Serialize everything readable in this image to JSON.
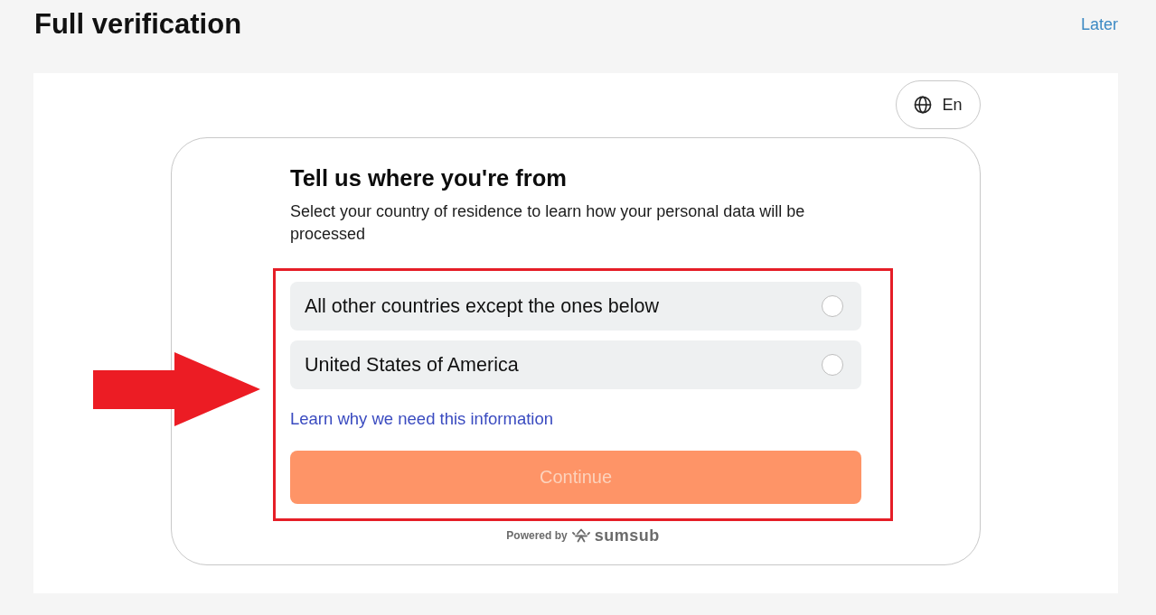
{
  "header": {
    "title": "Full verification",
    "later_link": "Later"
  },
  "language_button": {
    "label": "En"
  },
  "form": {
    "heading": "Tell us where you're from",
    "description": "Select your country of residence to learn how your personal data will be processed",
    "options": [
      {
        "label": "All other countries except the ones below",
        "selected": false
      },
      {
        "label": "United States of America",
        "selected": false
      }
    ],
    "info_link": "Learn why we need this information",
    "continue_button": {
      "label": "Continue",
      "disabled": true
    }
  },
  "footer": {
    "powered_by": "Powered by",
    "brand": "sumsub"
  },
  "annotations": {
    "arrow": true,
    "highlight_frame": true
  }
}
